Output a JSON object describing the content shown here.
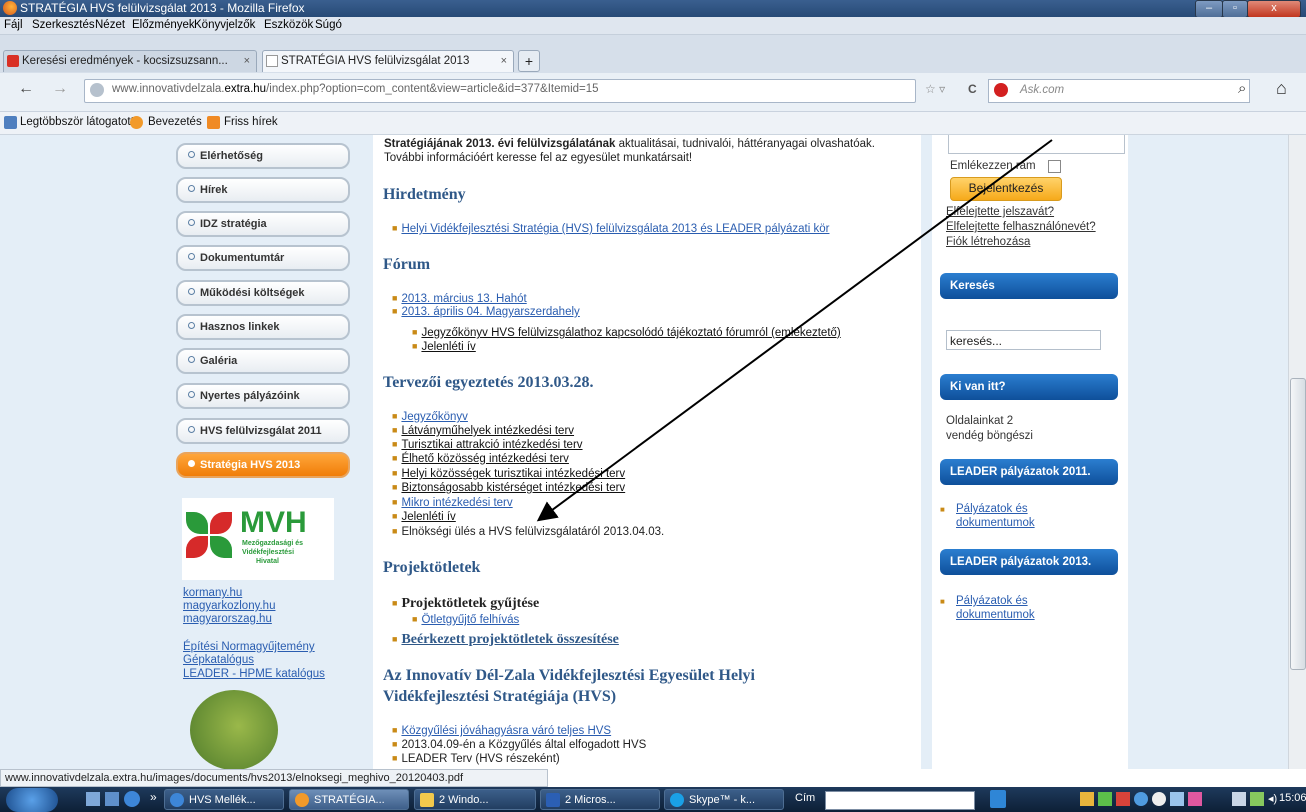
{
  "window": {
    "title": "STRATÉGIA HVS felülvizsgálat 2013 - Mozilla Firefox",
    "min": "–",
    "max": "▫",
    "close": "x"
  },
  "menubar": [
    "Fájl",
    "Szerkesztés",
    "Nézet",
    "Előzmények",
    "Könyvjelzők",
    "Eszközök",
    "Súgó"
  ],
  "tabs": [
    {
      "label": "Keresési eredmények - kocsizsuzsann...",
      "close": "×"
    },
    {
      "label": "STRATÉGIA HVS felülvizsgálat 2013",
      "close": "×"
    }
  ],
  "new_tab": "+",
  "nav": {
    "url_host": "www.innovativdelzala.",
    "url_bold": "extra.hu",
    "url_rest": "/index.php?option=com_content&view=article&id=377&Itemid=15",
    "search_placeholder": "Ask.com",
    "back": "←",
    "forward": "→",
    "home": "⌂",
    "search_icon": "⌕",
    "reload": "C",
    "star": "☆ ▿"
  },
  "bookmarks": [
    "Legtöbbször látogatott",
    "Bevezetés",
    "Friss hírek"
  ],
  "left_menu": [
    "Elérhetőség",
    "Hírek",
    "IDZ stratégia",
    "Dokumentumtár",
    "Működési költségek",
    "Hasznos linkek",
    "Galéria",
    "Nyertes pályázóink",
    "HVS felülvizsgálat 2011",
    "Stratégia HVS 2013"
  ],
  "logo": {
    "title": "MVH",
    "line1": "Mezőgazdasági és",
    "line2": "Vidékfejlesztési",
    "line3": "Hivatal"
  },
  "left_links": [
    "kormany.hu",
    "magyarkozlony.hu",
    "magyarorszag.hu",
    "Építési Normagyűjtemény",
    "Gépkatalógus",
    "LEADER - HPME katalógus"
  ],
  "main": {
    "intro_bold": "Stratégiájának 2013. évi felülvizsgálatának",
    "intro_rest": " aktualitásai, tudnivalói, háttéranyagai olvashatóak.",
    "intro2": "További információért keresse fel az egyesület munkatársait!",
    "h_hirdetmeny": "Hirdetmény",
    "hirdetmeny_item": "Helyi Vidékfejlesztési Stratégia (HVS) felülvizsgálata 2013 és LEADER pályázati kör",
    "h_forum": "Fórum",
    "forum1": "2013. március 13. Hahót",
    "forum2": "2013. április 04. Magyarszerdahely",
    "forum2a": "Jegyzőkönyv HVS felülvizsgálathoz kapcsolódó tájékoztató fórumról (emlékeztető)",
    "forum2b": "Jelenléti ív",
    "h_tervezoi": "Tervezői egyeztetés 2013.03.28.",
    "tervezoi": [
      "Jegyzőkönyv",
      "Látványműhelyek intézkedési terv",
      "Turisztikai attrakció intézkedési terv",
      "Élhető közösség intézkedési terv",
      "Helyi közösségek turisztikai intézkedési terv",
      "Biztonságosabb kistérséget intézkedési terv",
      "Mikro intézkedési terv",
      "Jelenléti ív"
    ],
    "elnoksegi": "Elnökségi ülés a HVS felülvizsgálatáról 2013.04.03.",
    "h_projekt": "Projektötletek",
    "projekt1": "Projektötletek gyűjtése",
    "projekt1a": "Ötletgyűjtő felhívás",
    "projekt2": "Beérkezett projektötletek összesítése",
    "h_egyesulet1": "Az Innovatív Dél-Zala Vidékfejlesztési Egyesület Helyi",
    "h_egyesulet2": "Vidékfejlesztési Stratégiája (HVS)",
    "egyesulet": [
      "Közgyűlési jóváhagyásra váró teljes HVS",
      "2013.04.09-én a Közgyűlés által elfogadott HVS",
      "LEADER Terv (HVS részeként)"
    ]
  },
  "right": {
    "remember": "Emlékezzen rám",
    "login_button": "Bejelentkezés",
    "forgot_pw": "Elfelejtette jelszavát?",
    "forgot_user": "Elfelejtette felhasználónevét?",
    "create": "Fiók létrehozása",
    "search_title": "Keresés",
    "search_value": "keresés...",
    "who_title": "Ki van itt?",
    "who1": "Oldalainkat 2",
    "who2": "vendég böngészi",
    "leader2011": "LEADER pályázatok 2011.",
    "leader2011_link1": "Pályázatok és",
    "leader2011_link2": "dokumentumok",
    "leader2013": "LEADER pályázatok 2013.",
    "leader2013_link1": "Pályázatok és",
    "leader2013_link2": "dokumentumok"
  },
  "status": "www.innovativdelzala.extra.hu/images/documents/hvs2013/elnoksegi_meghivo_20120403.pdf",
  "taskbar": {
    "items": [
      "HVS Mellék...",
      "STRATÉGIA...",
      "2 Windo...",
      "2 Micros...",
      "Skype™ - k..."
    ],
    "cim": "Cím",
    "clock": "15:06",
    "chevrons": "»"
  },
  "colors": {
    "accent": "#f07d08",
    "link": "#2a5db0",
    "heading": "#2f5888",
    "box": "#0e4f9a"
  }
}
